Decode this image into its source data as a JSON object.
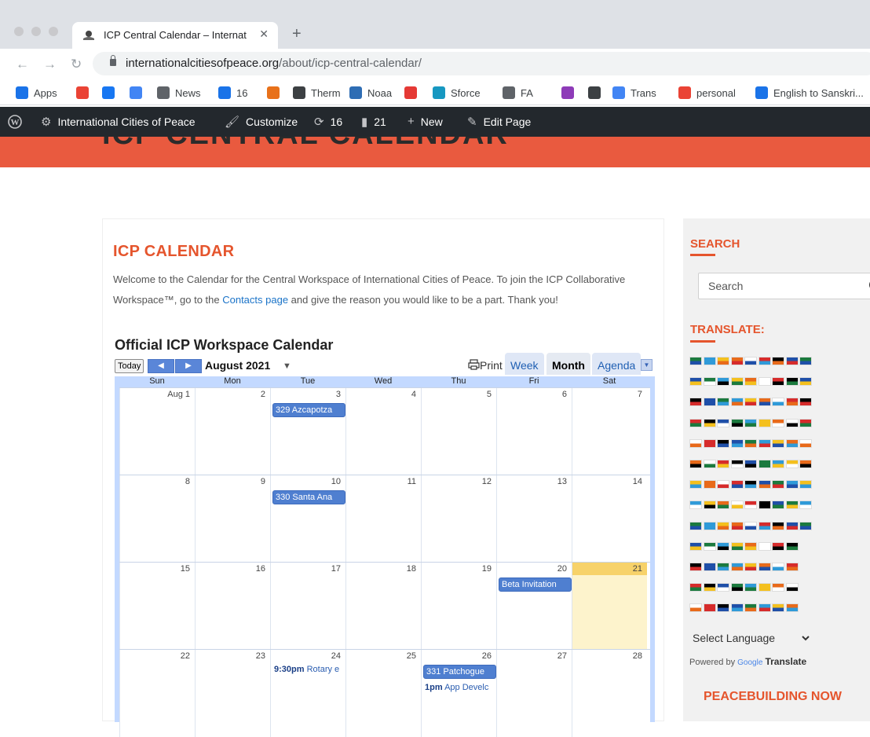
{
  "browser": {
    "tab_title": "ICP Central Calendar – Internat",
    "url_domain": "internationalcitiesofpeace.org",
    "url_path": "/about/icp-central-calendar/",
    "bookmarks": [
      {
        "label": "Apps",
        "icon": "apps-grid-icon",
        "color": "#1a73e8"
      },
      {
        "label": "",
        "icon": "google-icon",
        "color": "#ea4335"
      },
      {
        "label": "",
        "icon": "facebook-icon",
        "color": "#1877f2"
      },
      {
        "label": "",
        "icon": "calendar-icon",
        "color": "#4285f4"
      },
      {
        "label": "News",
        "icon": "folder-icon",
        "color": "#5f6368"
      },
      {
        "label": "16",
        "icon": "mail-icon",
        "color": "#1a73e8"
      },
      {
        "label": "",
        "icon": "chart-icon",
        "color": "#e8711a"
      },
      {
        "label": "Therm",
        "icon": "globe-icon",
        "color": "#3c4043"
      },
      {
        "label": "Noaa",
        "icon": "noaa-icon",
        "color": "#2e6db4"
      },
      {
        "label": "",
        "icon": "red-square-icon",
        "color": "#e53935"
      },
      {
        "label": "Sforce",
        "icon": "cloud-icon",
        "color": "#1798c1"
      },
      {
        "label": "FA",
        "icon": "folder-icon",
        "color": "#5f6368"
      },
      {
        "label": "",
        "icon": "heart-icon",
        "color": "#8e3bb8"
      },
      {
        "label": "",
        "icon": "globe-icon",
        "color": "#3c4043"
      },
      {
        "label": "Trans",
        "icon": "translate-icon",
        "color": "#4285f4"
      },
      {
        "label": "personal",
        "icon": "gmail-icon",
        "color": "#ea4335"
      },
      {
        "label": "English to Sanskri...",
        "icon": "circle-arrow-icon",
        "color": "#1a73e8"
      }
    ]
  },
  "adminbar": {
    "site_name": "International Cities of Peace",
    "customize": "Customize",
    "updates": "16",
    "comments": "21",
    "new": "New",
    "edit_page": "Edit Page"
  },
  "hero": {
    "title": "ICP CENTRAL CALENDAR"
  },
  "main": {
    "title": "ICP CALENDAR",
    "intro_before": "Welcome to the Calendar for the Central Workspace of International Cities of Peace. To join the ICP Collaborative Workspace™, go to the ",
    "intro_link": "Contacts page",
    "intro_after": " and give the reason you would like to be a part. Thank you!"
  },
  "calendar": {
    "title": "Official ICP Workspace Calendar",
    "today_label": "Today",
    "month_label": "August 2021",
    "print_label": "Print",
    "views": [
      "Week",
      "Month",
      "Agenda"
    ],
    "active_view": "Month",
    "weekdays": [
      "Sun",
      "Mon",
      "Tue",
      "Wed",
      "Thu",
      "Fri",
      "Sat"
    ],
    "weeks": [
      [
        "Aug 1",
        "2",
        "3",
        "4",
        "5",
        "6",
        "7"
      ],
      [
        "8",
        "9",
        "10",
        "11",
        "12",
        "13",
        "14"
      ],
      [
        "15",
        "16",
        "17",
        "18",
        "19",
        "20",
        "21"
      ],
      [
        "22",
        "23",
        "24",
        "25",
        "26",
        "27",
        "28"
      ]
    ],
    "events": [
      {
        "week": 0,
        "day": 2,
        "kind": "chip",
        "label": "329 Azcapotza"
      },
      {
        "week": 1,
        "day": 2,
        "kind": "chip",
        "label": "330 Santa Ana"
      },
      {
        "week": 2,
        "day": 5,
        "kind": "chip",
        "label": "Beta Invitation"
      },
      {
        "week": 3,
        "day": 2,
        "kind": "text",
        "time": "9:30pm",
        "label": " Rotary e"
      },
      {
        "week": 3,
        "day": 4,
        "kind": "chip",
        "label": "331 Patchogue"
      },
      {
        "week": 3,
        "day": 4,
        "kind": "text",
        "time": "1pm",
        "label": " App Develc"
      }
    ],
    "today_cell": {
      "week": 2,
      "day": 6
    }
  },
  "sidebar": {
    "search_heading": "SEARCH",
    "search_placeholder": "Search",
    "translate_heading": "TRANSLATE:",
    "language_select": "Select Language",
    "powered_by": "Powered by",
    "powered_google": "Google",
    "powered_translate": "Translate",
    "peacebuilding_heading": "PEACEBUILDING NOW"
  },
  "colors": {
    "accent": "#e5552d",
    "hero": "#e95a3f",
    "adminbar": "#23282d",
    "calendar_frame": "#c3d9ff",
    "event_chip": "#4f7fd0",
    "today_cell": "#fdf3cc"
  }
}
